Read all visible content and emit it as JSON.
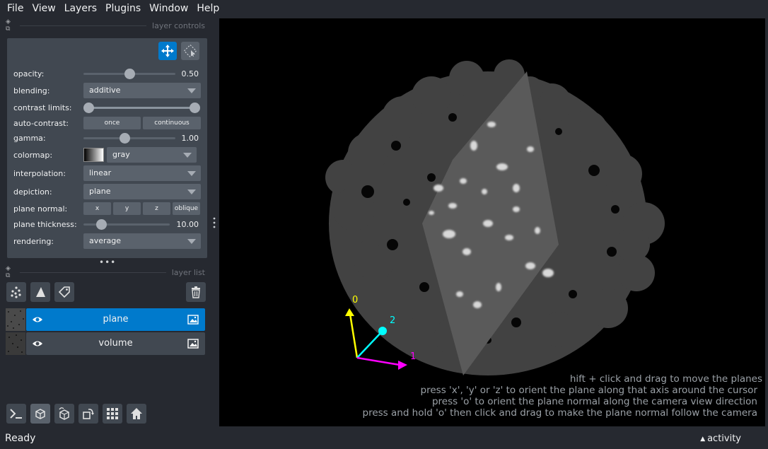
{
  "menu": [
    "File",
    "View",
    "Layers",
    "Plugins",
    "Window",
    "Help"
  ],
  "dock": {
    "controls_title": "layer controls",
    "list_title": "layer list"
  },
  "controls": {
    "opacity": {
      "label": "opacity:",
      "value": "0.50",
      "fraction": 0.5
    },
    "blending": {
      "label": "blending:",
      "value": "additive"
    },
    "contrast": {
      "label": "contrast limits:",
      "low": 0.0,
      "high": 1.0
    },
    "auto_contrast": {
      "label": "auto-contrast:",
      "once": "once",
      "continuous": "continuous"
    },
    "gamma": {
      "label": "gamma:",
      "value": "1.00",
      "fraction": 0.4
    },
    "colormap": {
      "label": "colormap:",
      "value": "gray"
    },
    "interpolation": {
      "label": "interpolation:",
      "value": "linear"
    },
    "depiction": {
      "label": "depiction:",
      "value": "plane"
    },
    "plane_normal": {
      "label": "plane normal:",
      "x": "x",
      "y": "y",
      "z": "z",
      "oblique": "oblique"
    },
    "plane_thickness": {
      "label": "plane thickness:",
      "value": "10.00",
      "fraction": 0.22
    },
    "rendering": {
      "label": "rendering:",
      "value": "average"
    }
  },
  "layers": [
    {
      "name": "plane",
      "selected": true
    },
    {
      "name": "volume",
      "selected": false
    }
  ],
  "axes": {
    "axis0": "0",
    "axis1": "1",
    "axis2": "2"
  },
  "hints": [
    "hift + click and drag to move the planes",
    "press 'x', 'y' or 'z' to orient the plane along that axis around the cursor",
    "press 'o' to orient the plane normal along the camera view direction",
    "press and hold 'o' then click and drag to make the plane normal follow the camera"
  ],
  "status": {
    "text": "Ready",
    "activity": "activity"
  },
  "colors": {
    "accent": "#007acc",
    "background": "#262930",
    "panel": "#414851",
    "axis0": "#ffff00",
    "axis1": "#ff00ff",
    "axis2": "#00ffff"
  }
}
